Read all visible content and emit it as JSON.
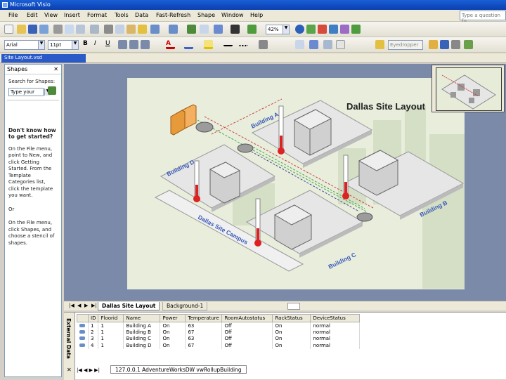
{
  "app": {
    "title": "Microsoft Visio",
    "help_placeholder": "Type a question fo"
  },
  "menu": [
    "File",
    "Edit",
    "View",
    "Insert",
    "Format",
    "Tools",
    "Data",
    "Fast-Refresh",
    "Shape",
    "Window",
    "Help"
  ],
  "toolbar": {
    "zoom": "42%",
    "font": "Arial",
    "font_size": "11pt",
    "styles": "Eyedropper"
  },
  "document": {
    "tab": "Site Layout.vsd",
    "title": "Dallas Site Layout"
  },
  "shapes_panel": {
    "title": "Shapes",
    "search_label": "Search for Shapes:",
    "search_placeholder": "Type your",
    "help_heading": "Don't know how to get started?",
    "help_1": "On the File menu, point to New, and click Getting Started. From the Template Categories list, click the template you want.",
    "or": "Or",
    "help_2": "On the File menu, click Shapes, and choose a stencil of shapes."
  },
  "diagram": {
    "labels": {
      "a": "Building A",
      "b": "Building B",
      "c": "Building C",
      "d": "Building D",
      "campus": "Dallas Site Campus"
    }
  },
  "sheets": [
    "Dallas Site Layout",
    "Background-1"
  ],
  "external_data": {
    "label": "External Data",
    "columns": [
      "",
      "ID",
      "Floorid",
      "Name",
      "Power",
      "Temperature",
      "RoomAutostatus",
      "RackStatus",
      "DeviceStatus"
    ],
    "rows": [
      [
        "1",
        "1",
        "Building A",
        "On",
        "63",
        "Off",
        "On",
        "normal"
      ],
      [
        "2",
        "1",
        "Building B",
        "On",
        "67",
        "Off",
        "On",
        "normal"
      ],
      [
        "3",
        "1",
        "Building C",
        "On",
        "63",
        "Off",
        "On",
        "normal"
      ],
      [
        "4",
        "1",
        "Building D",
        "On",
        "67",
        "Off",
        "On",
        "normal"
      ]
    ],
    "link_tab": "127.0.0.1 AdventureWorksDW vwRollupBuilding"
  }
}
